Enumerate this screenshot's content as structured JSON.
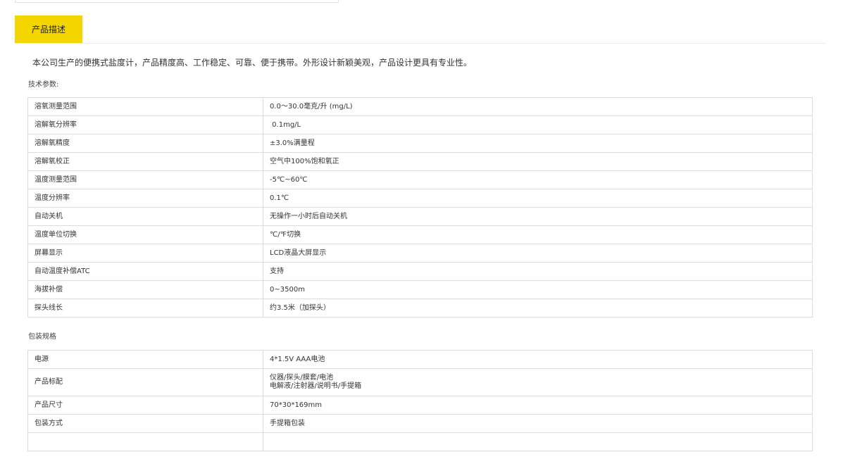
{
  "tab": {
    "label": "产品描述"
  },
  "intro": "本公司生产的便携式盐度计，产品精度高、工作稳定、可靠、便于携带。外形设计新颖美观，产品设计更具有专业性。",
  "tech_section": {
    "title": "技术参数:",
    "rows": [
      {
        "key": "溶氧测量范围",
        "value": "0.0～30.0毫克/升 (mg/L)"
      },
      {
        "key": "溶解氧分辨率",
        "value": " 0.1mg/L"
      },
      {
        "key": "溶解氧精度",
        "value": "±3.0%满量程"
      },
      {
        "key": "溶解氧校正",
        "value": "空气中100%饱和氧正"
      },
      {
        "key": "温度测量范围",
        "value": "-5℃~60℃"
      },
      {
        "key": "温度分辨率",
        "value": "0.1℃"
      },
      {
        "key": "自动关机",
        "value": "无操作一小时后自动关机"
      },
      {
        "key": "温度单位切换",
        "value": "℃/℉切换"
      },
      {
        "key": "屏幕显示",
        "value": "LCD液晶大屏显示"
      },
      {
        "key": "自动温度补偿ATC",
        "value": "支持"
      },
      {
        "key": "海拔补偿",
        "value": "0~3500m"
      },
      {
        "key": "探头线长",
        "value": "约3.5米（加探头）"
      }
    ]
  },
  "package_section": {
    "title": "包装规格",
    "rows": [
      {
        "key": "电源",
        "value": "4*1.5V AAA电池"
      },
      {
        "key": "产品标配",
        "value_line1": "仪器/探头/膜套/电池",
        "value_line2": "电解液/注射器/说明书/手提箱"
      },
      {
        "key": "产品尺寸",
        "value": "70*30*169mm"
      },
      {
        "key": "包装方式",
        "value": "手提箱包装"
      },
      {
        "key": "",
        "value": ""
      }
    ]
  }
}
